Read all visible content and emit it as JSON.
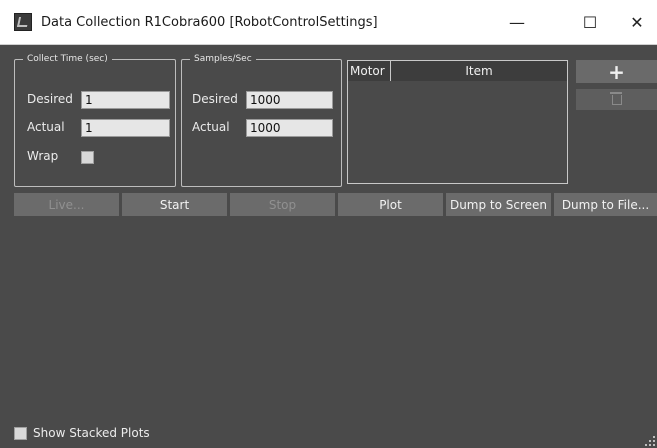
{
  "window": {
    "title": "Data Collection R1Cobra600 [RobotControlSettings]",
    "minimize_glyph": "—",
    "maximize_glyph": "☐",
    "close_glyph": "✕"
  },
  "collect_time": {
    "legend": "Collect Time (sec)",
    "desired_label": "Desired",
    "desired_value": "1",
    "actual_label": "Actual",
    "actual_value": "1",
    "wrap_label": "Wrap",
    "wrap_checked": false
  },
  "samples": {
    "legend": "Samples/Sec",
    "desired_label": "Desired",
    "desired_value": "1000",
    "actual_label": "Actual",
    "actual_value": "1000"
  },
  "item_list": {
    "columns": [
      "Motor",
      "Item"
    ],
    "rows": []
  },
  "side_buttons": {
    "add_glyph": "+",
    "delete_icon": "trash-icon"
  },
  "toolbar": {
    "live": "Live...",
    "start": "Start",
    "stop": "Stop",
    "plot": "Plot",
    "dump_screen": "Dump to Screen",
    "dump_file": "Dump to File..."
  },
  "footer": {
    "stacked_label": "Show Stacked Plots",
    "stacked_checked": false
  },
  "colors": {
    "background": "#4a4a4a",
    "button": "#6b6b6b",
    "disabled_text": "#909090"
  }
}
